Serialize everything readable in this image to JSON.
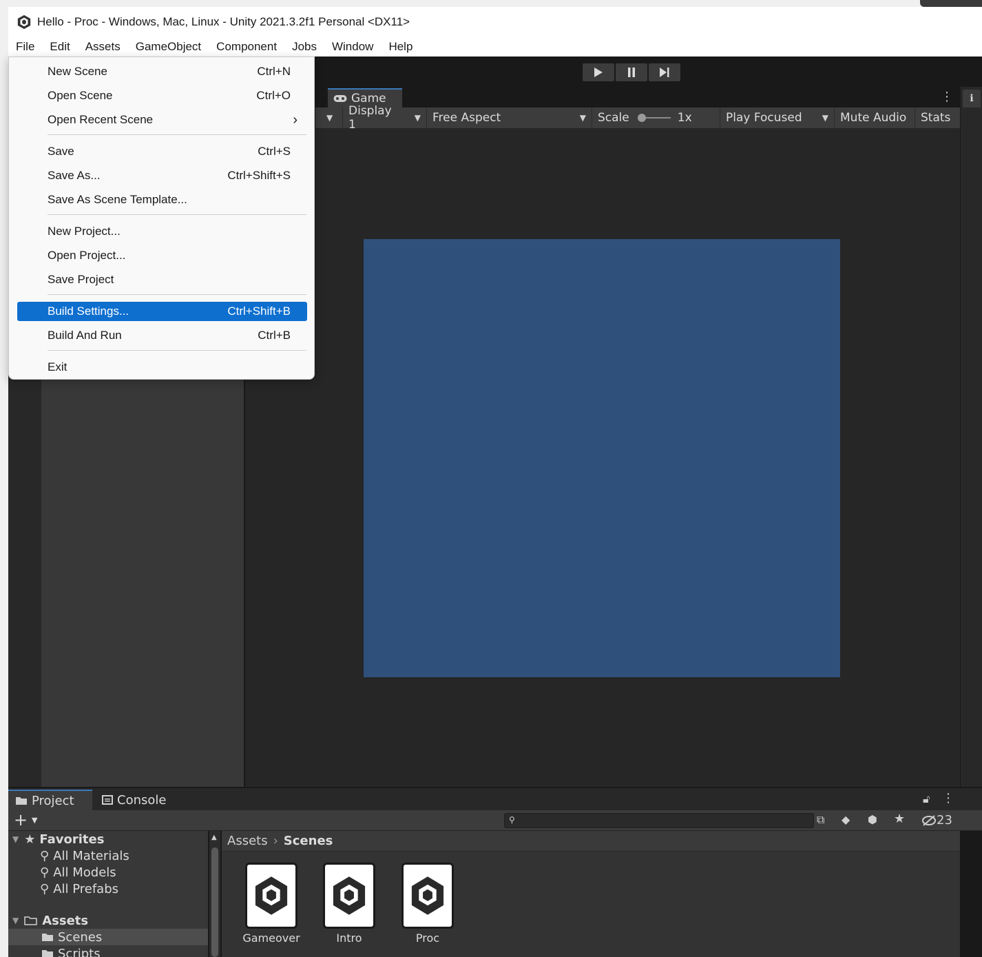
{
  "window": {
    "title": "Hello - Proc - Windows, Mac, Linux - Unity 2021.3.2f1 Personal <DX11>"
  },
  "menubar": [
    "File",
    "Edit",
    "Assets",
    "GameObject",
    "Component",
    "Jobs",
    "Window",
    "Help"
  ],
  "file_menu": {
    "items": [
      {
        "label": "New Scene",
        "shortcut": "Ctrl+N"
      },
      {
        "label": "Open Scene",
        "shortcut": "Ctrl+O"
      },
      {
        "label": "Open Recent Scene",
        "shortcut": "›"
      },
      {
        "label": "Save",
        "shortcut": "Ctrl+S"
      },
      {
        "label": "Save As...",
        "shortcut": "Ctrl+Shift+S"
      },
      {
        "label": "Save As Scene Template...",
        "shortcut": ""
      },
      {
        "label": "New Project...",
        "shortcut": ""
      },
      {
        "label": "Open Project...",
        "shortcut": ""
      },
      {
        "label": "Save Project",
        "shortcut": ""
      },
      {
        "label": "Build Settings...",
        "shortcut": "Ctrl+Shift+B"
      },
      {
        "label": "Build And Run",
        "shortcut": "Ctrl+B"
      },
      {
        "label": "Exit",
        "shortcut": ""
      }
    ],
    "highlighted": "Build Settings..."
  },
  "game_view": {
    "tab_label": "Game",
    "display": "Display 1",
    "aspect": "Free Aspect",
    "scale_label": "Scale",
    "scale_value": "1x",
    "play_mode": "Play Focused",
    "mute": "Mute Audio",
    "stats": "Stats",
    "canvas_color": "#30507c"
  },
  "project": {
    "tabs": [
      "Project",
      "Console"
    ],
    "hidden_count": "23",
    "favorites": {
      "label": "Favorites",
      "items": [
        "All Materials",
        "All Models",
        "All Prefabs"
      ]
    },
    "assets": {
      "label": "Assets",
      "items": [
        "Scenes",
        "Scripts"
      ],
      "selected": "Scenes"
    },
    "breadcrumb": {
      "root": "Assets",
      "current": "Scenes"
    },
    "files": [
      "Gameover",
      "Intro",
      "Proc"
    ]
  },
  "colors": {
    "accent": "#3a79bb",
    "menu_highlight": "#0e6fcf"
  }
}
